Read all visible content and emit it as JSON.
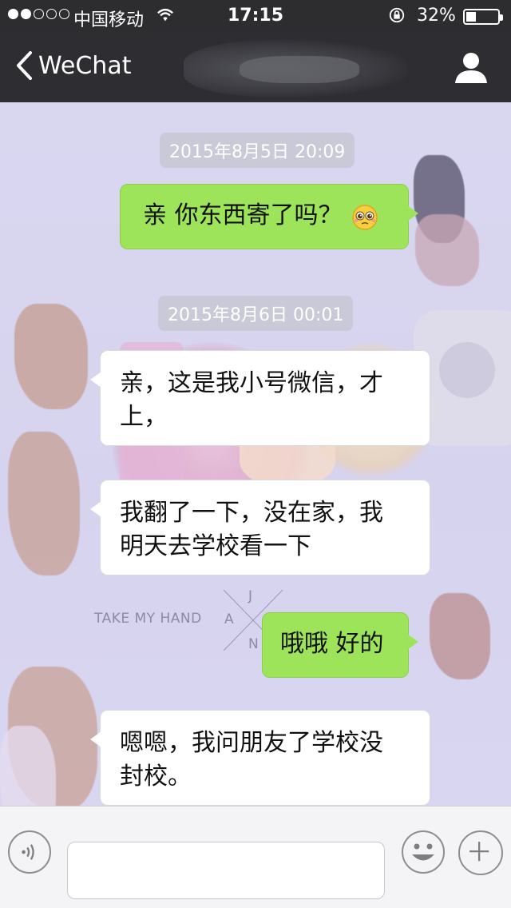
{
  "status": {
    "carrier": "中国移动",
    "time": "17:15",
    "battery": "32%",
    "battery_level": 0.32,
    "signal_bars_filled": 2,
    "signal_bars_total": 5
  },
  "nav": {
    "back_label": "WeChat",
    "back_icon": "chevron-left-icon",
    "profile_icon": "person-icon"
  },
  "messages": [
    {
      "type": "timestamp",
      "text": "2015年8月5日 20:09"
    },
    {
      "type": "me",
      "text": "亲 你东西寄了吗？",
      "emoji": "pleading-face-emoji"
    },
    {
      "type": "timestamp",
      "text": "2015年8月6日 00:01"
    },
    {
      "type": "them",
      "line1": "亲，这是我小号微信，才",
      "line2": "上，"
    },
    {
      "type": "them",
      "line1": "我翻了一下，没在家，我",
      "line2": "明天去学校看一下"
    },
    {
      "type": "me",
      "text": "哦哦 好的"
    },
    {
      "type": "them",
      "line1": "嗯嗯，我问朋友了学校没",
      "line2": "封校。"
    }
  ],
  "wallpaper": {
    "caption": "TAKE MY HAND",
    "letters": [
      "J",
      "A",
      "N"
    ]
  },
  "input_bar": {
    "voice_icon": "voice-icon",
    "emoji_icon": "emoji-icon",
    "plus_icon": "plus-icon"
  },
  "colors": {
    "bubble_me": "#9ee45a",
    "bubble_them": "#ffffff",
    "nav_bg": "#2e2e32",
    "chat_bg": "#d7d5ee"
  }
}
